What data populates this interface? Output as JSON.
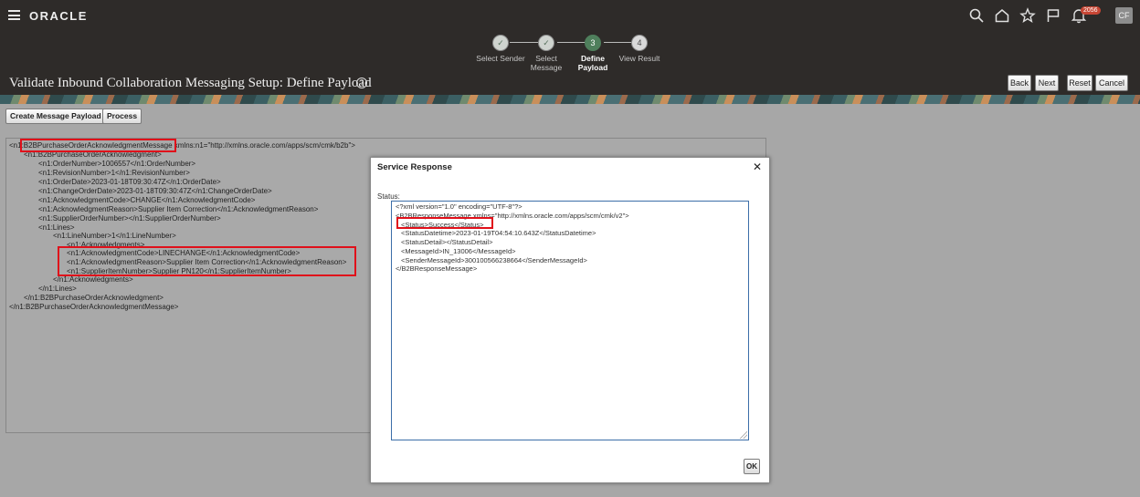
{
  "header": {
    "brand": "ORACLE",
    "icons": [
      "search-icon",
      "home-icon",
      "star-icon",
      "flag-icon",
      "bell-icon"
    ],
    "notification_count": "2056",
    "user_initials": "CF"
  },
  "train": {
    "steps": [
      {
        "number": "✓",
        "label_line1": "Select Sender",
        "label_line2": "",
        "status": "done"
      },
      {
        "number": "✓",
        "label_line1": "Select",
        "label_line2": "Message",
        "status": "done"
      },
      {
        "number": "3",
        "label_line1": "Define",
        "label_line2": "Payload",
        "status": "current"
      },
      {
        "number": "4",
        "label_line1": "View Result",
        "label_line2": "",
        "status": "pending"
      }
    ]
  },
  "page": {
    "title": "Validate Inbound Collaboration Messaging Setup: Define Payload",
    "help_icon_glyph": "?"
  },
  "nav_buttons": {
    "back": "Back",
    "next": "Next",
    "reset": "Reset",
    "cancel": "Cancel"
  },
  "actions": {
    "create_payload": "Create Message Payload",
    "process": "Process"
  },
  "payload_lines": [
    "<n1:B2BPurchaseOrderAcknowledgmentMessage xmlns:n1=\"http://xmlns.oracle.com/apps/scm/cmk/b2b\">",
    "<n1:B2BPurchaseOrderAcknowledgment>",
    "<n1:OrderNumber>1006557</n1:OrderNumber>",
    "<n1:RevisionNumber>1</n1:RevisionNumber>",
    "<n1:OrderDate>2023-01-18T09:30:47Z</n1:OrderDate>",
    "<n1:ChangeOrderDate>2023-01-18T09:30:47Z</n1:ChangeOrderDate>",
    "<n1:AcknowledgmentCode>CHANGE</n1:AcknowledgmentCode>",
    "<n1:AcknowledgmentReason>Supplier Item Correction</n1:AcknowledgmentReason>",
    "<n1:SupplierOrderNumber></n1:SupplierOrderNumber>",
    "<n1:Lines>",
    "<n1:LineNumber>1</n1:LineNumber>",
    "<n1:Acknowledgments>",
    "<n1:AcknowledgmentCode>LINECHANGE</n1:AcknowledgmentCode>",
    "<n1:AcknowledgmentReason>Supplier Item Correction</n1:AcknowledgmentReason>",
    "<n1:SupplierItemNumber>Supplier PN120</n1:SupplierItemNumber>",
    "</n1:Acknowledgments>",
    "</n1:Lines>",
    "</n1:B2BPurchaseOrderAcknowledgment>",
    "</n1:B2BPurchaseOrderAcknowledgmentMessage>"
  ],
  "modal": {
    "title": "Service Response",
    "close_glyph": "✕",
    "status_label": "Status:",
    "response_lines": [
      "<?xml version=\"1.0\" encoding=\"UTF-8\"?>",
      "<B2BResponseMessage xmlns=\"http://xmlns.oracle.com/apps/scm/cmk/v2\">",
      "<Status>Success</Status>",
      "<StatusDatetime>2023-01-19T04:54:10.643Z</StatusDatetime>",
      "<StatusDetail></StatusDetail>",
      "<MessageId>IN_13006</MessageId>",
      "<SenderMessageId>300100566238664</SenderMessageId>",
      "</B2BResponseMessage>"
    ],
    "ok_label": "OK"
  },
  "colors": {
    "header_bg": "#2e2b29",
    "current_step": "#4f7f5c",
    "highlight": "#e0101a",
    "modal_border": "#3c6ea8"
  }
}
